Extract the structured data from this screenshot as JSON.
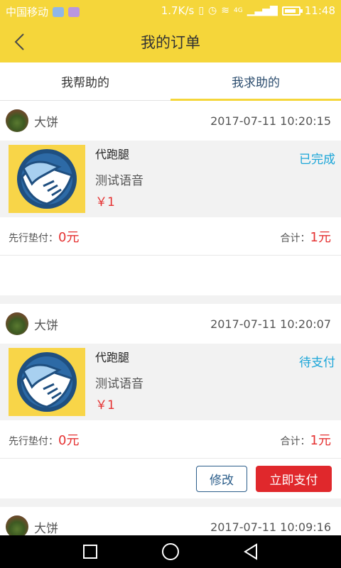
{
  "status_bar": {
    "carrier": "中国移动",
    "speed": "1.7K/s",
    "network": "4G",
    "time": "11:48"
  },
  "header": {
    "title": "我的订单"
  },
  "tabs": [
    {
      "label": "我帮助的",
      "active": false
    },
    {
      "label": "我求助的",
      "active": true
    }
  ],
  "orders": [
    {
      "user": "大饼",
      "time": "2017-07-11 10:20:15",
      "service": "代跑腿",
      "description": "测试语音",
      "price": "￥1",
      "status": "已完成",
      "advance_label": "先行垫付：",
      "advance_value": "0元",
      "total_label": "合计：",
      "total_value": "1元"
    },
    {
      "user": "大饼",
      "time": "2017-07-11 10:20:07",
      "service": "代跑腿",
      "description": "测试语音",
      "price": "￥1",
      "status": "待支付",
      "advance_label": "先行垫付：",
      "advance_value": "0元",
      "total_label": "合计：",
      "total_value": "1元",
      "actions": {
        "modify": "修改",
        "pay": "立即支付"
      }
    },
    {
      "user": "大饼",
      "time": "2017-07-11 10:09:16"
    }
  ],
  "colors": {
    "brand_yellow": "#f5d63a",
    "price_red": "#e53131",
    "status_blue": "#1aa5d8",
    "pay_button": "#e0282c"
  }
}
